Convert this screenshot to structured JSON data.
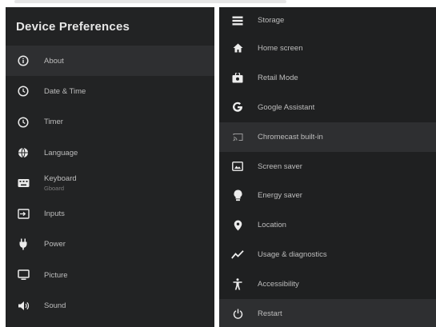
{
  "left_panel": {
    "title": "Device Preferences",
    "items": [
      {
        "label": "About",
        "icon": "info-icon",
        "selected": true
      },
      {
        "label": "Date & Time",
        "icon": "clock-icon"
      },
      {
        "label": "Timer",
        "icon": "timer-icon"
      },
      {
        "label": "Language",
        "icon": "globe-icon"
      },
      {
        "label": "Keyboard",
        "sub": "Gboard",
        "icon": "keyboard-icon"
      },
      {
        "label": "Inputs",
        "icon": "input-icon"
      },
      {
        "label": "Power",
        "icon": "power-plug-icon"
      },
      {
        "label": "Picture",
        "icon": "monitor-icon"
      },
      {
        "label": "Sound",
        "icon": "speaker-icon"
      }
    ]
  },
  "right_panel": {
    "items": [
      {
        "label": "Storage",
        "icon": "storage-icon"
      },
      {
        "label": "Home screen",
        "icon": "home-icon"
      },
      {
        "label": "Retail Mode",
        "icon": "shop-bag-icon"
      },
      {
        "label": "Google Assistant",
        "icon": "google-g-icon"
      },
      {
        "label": "Chromecast built-in",
        "icon": "cast-icon",
        "selected": true
      },
      {
        "label": "Screen saver",
        "icon": "screensaver-icon"
      },
      {
        "label": "Energy saver",
        "icon": "bulb-icon"
      },
      {
        "label": "Location",
        "icon": "location-pin-icon"
      },
      {
        "label": "Usage & diagnostics",
        "icon": "chart-line-icon"
      },
      {
        "label": "Accessibility",
        "icon": "accessibility-icon"
      },
      {
        "label": "Restart",
        "icon": "restart-icon",
        "selected": true
      }
    ]
  },
  "colors": {
    "panel_bg": "#222324",
    "selected_bg": "#2e2f31",
    "text": "#bdbdbd",
    "title": "#e6e6e6"
  }
}
